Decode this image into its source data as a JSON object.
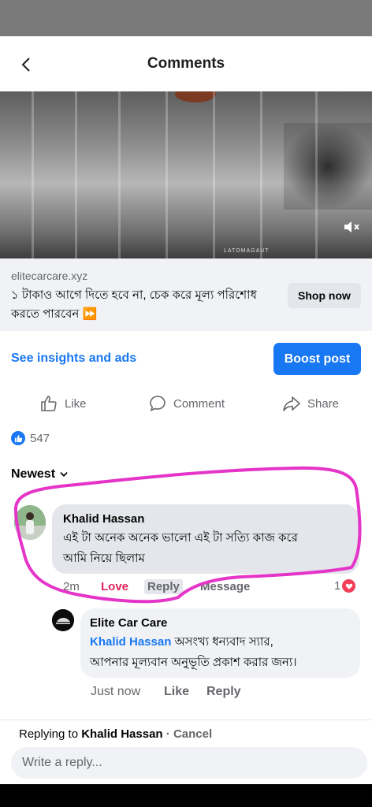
{
  "header": {
    "title": "Comments"
  },
  "video": {
    "watermark": "LATOMAGAUT"
  },
  "ad": {
    "domain": "elitecarcare.xyz",
    "text": "১ টাকাও আগে দিতে হবে না, চেক করে মূল্য পরিশোধ করতে পারবেন ⏩",
    "cta": "Shop now"
  },
  "insights": {
    "link": "See insights and ads",
    "boost": "Boost post"
  },
  "actions": {
    "like": "Like",
    "comment": "Comment",
    "share": "Share"
  },
  "reactions": {
    "count": "547"
  },
  "sort": {
    "label": "Newest"
  },
  "comments": [
    {
      "author": "Khalid Hassan",
      "text_line1": "এই টা অনেক অনেক ভালো এই টা সত্যি কাজ করে",
      "text_line2": "আমি নিয়ে ছিলাম",
      "time": "2m",
      "reaction_label": "Love",
      "reply_label": "Reply",
      "message_label": "Message",
      "reaction_count": "1"
    }
  ],
  "reply": {
    "author": "Elite Car Care",
    "mention": "Khalid Hassan",
    "text_line1": " অসংখ্য ধন্যবাদ স্যার,",
    "text_line2": "আপনার মূল্যবান অনুভূতি প্রকাশ করার জন্য।",
    "time": "Just now",
    "like_label": "Like",
    "reply_label": "Reply"
  },
  "composer": {
    "replying_prefix": "Replying to",
    "replying_to": "Khalid Hassan",
    "separator": "·",
    "cancel": "Cancel",
    "placeholder": "Write a reply..."
  },
  "colors": {
    "accent": "#1877f2",
    "love": "#e0245e",
    "highlight_ring": "#e535c9"
  }
}
